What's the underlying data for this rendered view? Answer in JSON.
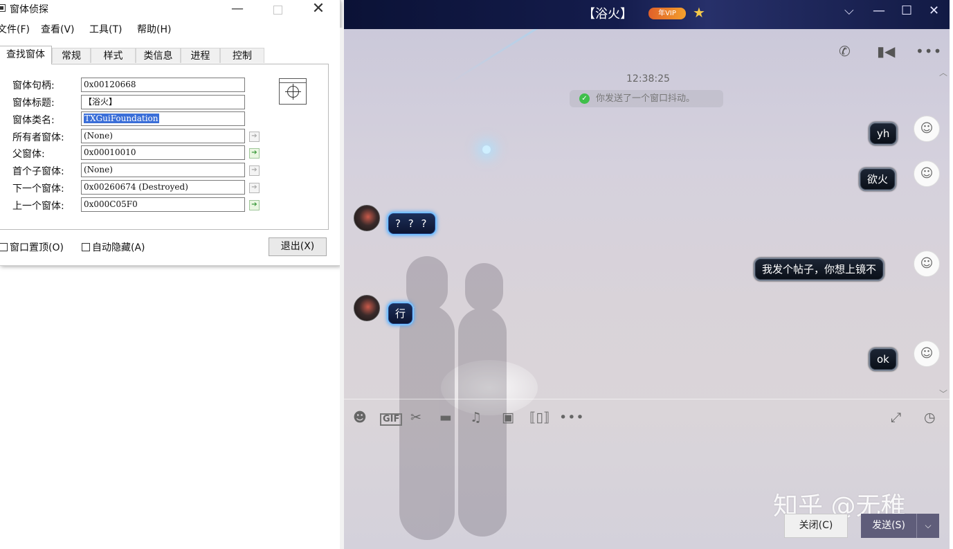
{
  "spy": {
    "title": "窗体侦探",
    "menu": [
      "文件(F)",
      "查看(V)",
      "工具(T)",
      "帮助(H)"
    ],
    "tabs": [
      "查找窗体",
      "常规",
      "样式",
      "类信息",
      "进程",
      "控制"
    ],
    "fields": [
      {
        "label": "窗体句柄:",
        "value": "0x00120668"
      },
      {
        "label": "窗体标题:",
        "value": "【浴火】"
      },
      {
        "label": "窗体类名:",
        "value": "TXGuiFoundation"
      },
      {
        "label": "所有者窗体:",
        "value": "(None)"
      },
      {
        "label": "父窗体:",
        "value": "0x00010010"
      },
      {
        "label": "首个子窗体:",
        "value": "(None)"
      },
      {
        "label": "下一个窗体:",
        "value": "0x00260674 (Destroyed)"
      },
      {
        "label": "上一个窗体:",
        "value": "0x000C05F0"
      }
    ],
    "checkbox_topmost": "窗口置顶(O)",
    "checkbox_autohide": "自动隐藏(A)",
    "exit_label": "退出(X)"
  },
  "chat": {
    "title": "【浴火】",
    "vip_badge": "年VIP",
    "timestamp": "12:38:25",
    "system_message": "你发送了一个窗口抖动。",
    "messages": [
      {
        "side": "out",
        "text": "yh"
      },
      {
        "side": "out",
        "text": "欲火"
      },
      {
        "side": "in",
        "text": "? ? ?"
      },
      {
        "side": "out",
        "text": "我发个帖子，你想上镜不"
      },
      {
        "side": "in",
        "text": "行"
      },
      {
        "side": "out",
        "text": "ok"
      }
    ],
    "close_label": "关闭(C)",
    "send_label": "发送(S)",
    "watermark": "知乎 @无稚"
  },
  "colors": {
    "selection": "#3a6ed8",
    "send_button": "#5f5d7a",
    "title_bar": "#141c4c"
  }
}
